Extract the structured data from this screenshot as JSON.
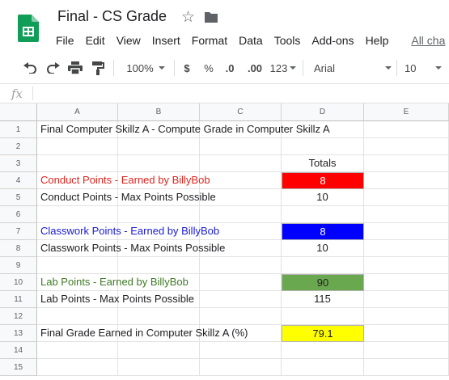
{
  "app": {
    "doc_title": "Final - CS Grade",
    "menu": [
      "File",
      "Edit",
      "View",
      "Insert",
      "Format",
      "Data",
      "Tools",
      "Add-ons",
      "Help"
    ],
    "all_changes_link": "All cha"
  },
  "toolbar": {
    "zoom": "100%",
    "currency": "$",
    "percent": "%",
    "decrease_decimals": ".0",
    "increase_decimals": ".00",
    "more_formats": "123",
    "font": "Arial",
    "font_size": "10"
  },
  "formula_bar": {
    "fx_label": "fx",
    "value": ""
  },
  "grid": {
    "columns": [
      "A",
      "B",
      "C",
      "D",
      "E"
    ],
    "rows": [
      "1",
      "2",
      "3",
      "4",
      "5",
      "6",
      "7",
      "8",
      "9",
      "10",
      "11",
      "12",
      "13",
      "14",
      "15"
    ],
    "row1_title": "Final Computer Skillz A - Compute Grade in Computer Skillz A",
    "totals_header": "Totals",
    "conduct_earned_label": "Conduct Points - Earned by BillyBob",
    "conduct_earned_value": "8",
    "conduct_max_label": "Conduct Points - Max Points Possible",
    "conduct_max_value": "10",
    "classwork_earned_label": "Classwork Points - Earned by BillyBob",
    "classwork_earned_value": "8",
    "classwork_max_label": "Classwork Points - Max Points Possible",
    "classwork_max_value": "10",
    "lab_earned_label": "Lab Points - Earned by BillyBob",
    "lab_earned_value": "90",
    "lab_max_label": "Lab Points - Max Points Possible",
    "lab_max_value": "115",
    "final_grade_label": "Final Grade Earned in Computer Skillz A (%)",
    "final_grade_value": "79.1"
  },
  "colors": {
    "conduct_text": "#e0241e",
    "conduct_fill": "#ff0000",
    "classwork_text": "#1a1ad6",
    "classwork_fill": "#0000ff",
    "lab_text": "#3f7a25",
    "lab_fill": "#6aa84f",
    "grade_fill": "#ffff00",
    "sheets_green": "#0f9d58"
  }
}
